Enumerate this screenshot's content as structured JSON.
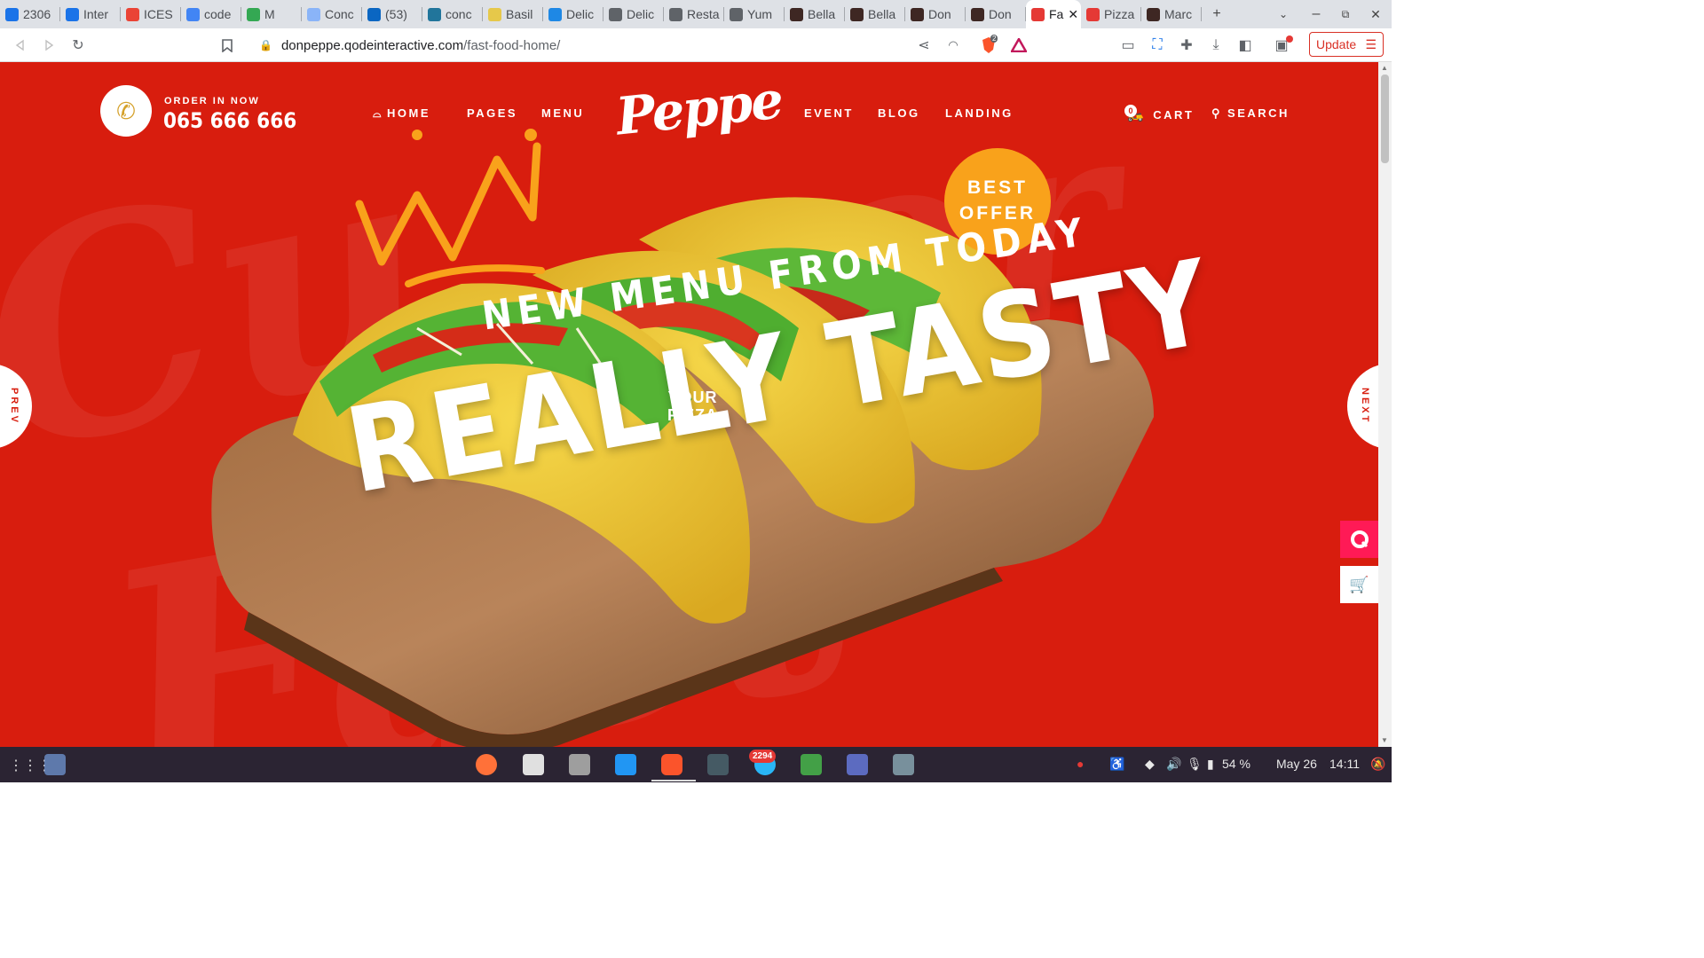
{
  "browser": {
    "tabs": [
      {
        "title": "2306",
        "icon": "is-icon",
        "color": "#1a73e8"
      },
      {
        "title": "Inter",
        "icon": "is-icon",
        "color": "#1a73e8"
      },
      {
        "title": "ICES",
        "icon": "gmail-icon",
        "color": "#ea4335"
      },
      {
        "title": "code",
        "icon": "google-icon",
        "color": "#4285f4"
      },
      {
        "title": "M",
        "icon": "meet-icon",
        "color": "#34a853"
      },
      {
        "title": "Conc",
        "icon": "feather-icon",
        "color": "#8ab4f8"
      },
      {
        "title": "(53)",
        "icon": "linkedin-icon",
        "color": "#0a66c2"
      },
      {
        "title": "conc",
        "icon": "wordpress-icon",
        "color": "#21759b"
      },
      {
        "title": "Basil",
        "icon": "basil-icon",
        "color": "#e6c84a"
      },
      {
        "title": "Delic",
        "icon": "delic-icon",
        "color": "#1e88e5"
      },
      {
        "title": "Delic",
        "icon": "globe-icon",
        "color": "#5f6368"
      },
      {
        "title": "Resta",
        "icon": "globe-icon",
        "color": "#5f6368"
      },
      {
        "title": "Yum",
        "icon": "globe-icon",
        "color": "#5f6368"
      },
      {
        "title": "Bella",
        "icon": "bella-icon",
        "color": "#3e2723"
      },
      {
        "title": "Bella",
        "icon": "bella-icon",
        "color": "#3e2723"
      },
      {
        "title": "Don",
        "icon": "don-icon",
        "color": "#3e2723"
      },
      {
        "title": "Don",
        "icon": "don-icon",
        "color": "#3e2723"
      },
      {
        "title": "Fa",
        "icon": "peppe-icon",
        "color": "#e53935",
        "active": true
      },
      {
        "title": "Pizza",
        "icon": "peppe-icon",
        "color": "#e53935"
      },
      {
        "title": "Marc",
        "icon": "marc-icon",
        "color": "#3e2723"
      }
    ],
    "url_host": "donpeppe.qodeinteractive.com",
    "url_path": "/fast-food-home/",
    "update_label": "Update",
    "brave_badge": "2"
  },
  "site": {
    "order_label": "ORDER IN NOW",
    "order_phone": "065 666 666",
    "nav_left": [
      "HOME",
      "PAGES",
      "MENU"
    ],
    "logo": "Peppe",
    "nav_right": [
      "EVENT",
      "BLOG",
      "LANDING"
    ],
    "cart_label": "CART",
    "cart_count": "0",
    "search_label": "SEARCH",
    "best_offer_line1": "BEST",
    "best_offer_line2": "OFFER",
    "headline_small": "NEW MENU FROM TODAY",
    "headline_big": "REALLY TASTY",
    "sub_line1": "YOUR",
    "sub_line2": "PIZZA",
    "prev_label": "PREV",
    "next_label": "NEXT",
    "accent_color": "#d81d0e",
    "offer_color": "#f9a21b",
    "side_button_color": "#ff1a56"
  },
  "taskbar": {
    "telegram_badge": "2294",
    "battery": "54 %",
    "date": "May 26",
    "time": "14:11"
  }
}
